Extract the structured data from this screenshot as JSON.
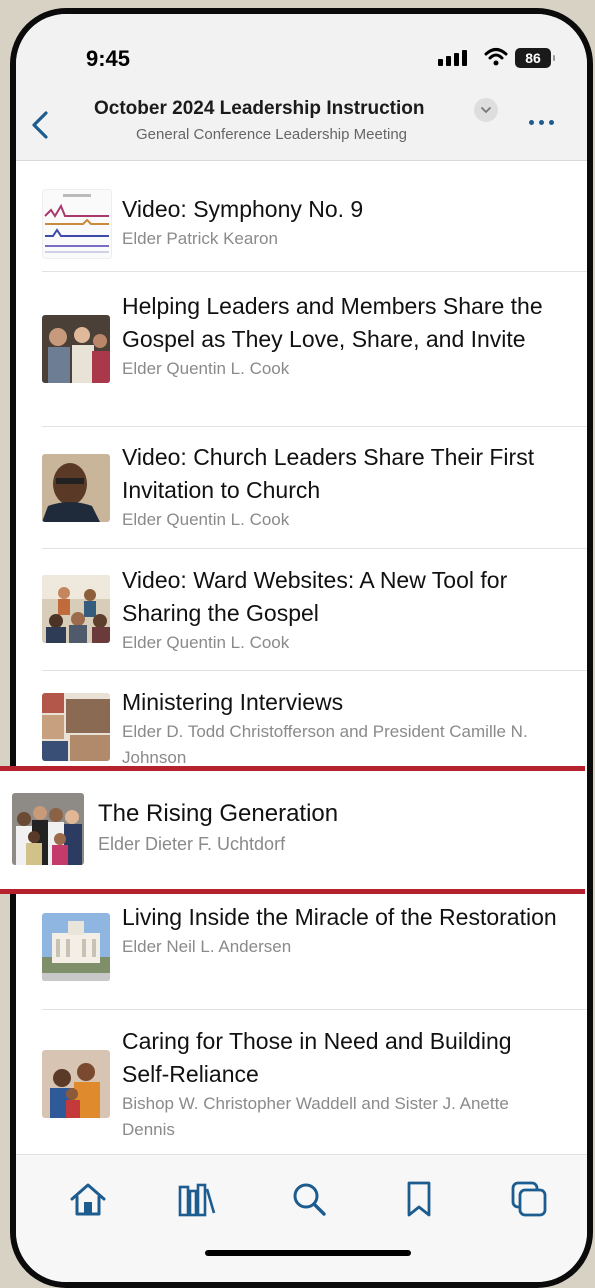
{
  "status": {
    "time": "9:45",
    "battery": "86"
  },
  "header": {
    "title": "October 2024 Leadership Instruction",
    "subtitle": "General Conference Leadership Meeting"
  },
  "items": [
    {
      "title": "Video: Symphony No. 9",
      "author": "Elder Patrick Kearon"
    },
    {
      "title": "Helping Leaders and Members Share the Gospel as They Love, Share, and Invite",
      "author": "Elder Quentin L. Cook"
    },
    {
      "title": "Video: Church Leaders Share Their First Invitation to Church",
      "author": "Elder Quentin L. Cook"
    },
    {
      "title": "Video: Ward Websites: A New Tool for Sharing the Gospel",
      "author": "Elder Quentin L. Cook"
    },
    {
      "title": "Ministering Interviews",
      "author": "Elder D. Todd Christofferson and President Camille N. Johnson"
    },
    {
      "title": "The Rising Generation",
      "author": "Elder Dieter F. Uchtdorf"
    },
    {
      "title": "Living Inside the Miracle of the Restoration",
      "author": "Elder Neil L. Andersen"
    },
    {
      "title": "Caring for Those in Need and Building Self-Reliance",
      "author": "Bishop W. Christopher Waddell and Sister J. Anette Dennis"
    }
  ],
  "tabs": [
    {
      "name": "home",
      "icon": "home-icon"
    },
    {
      "name": "library",
      "icon": "library-icon"
    },
    {
      "name": "search",
      "icon": "search-icon"
    },
    {
      "name": "bookmarks",
      "icon": "bookmark-icon"
    },
    {
      "name": "screens",
      "icon": "screens-icon"
    }
  ],
  "colors": {
    "accent": "#1d5c8f",
    "highlight_border": "#b5222d",
    "author_gray": "#8a8a8a"
  }
}
